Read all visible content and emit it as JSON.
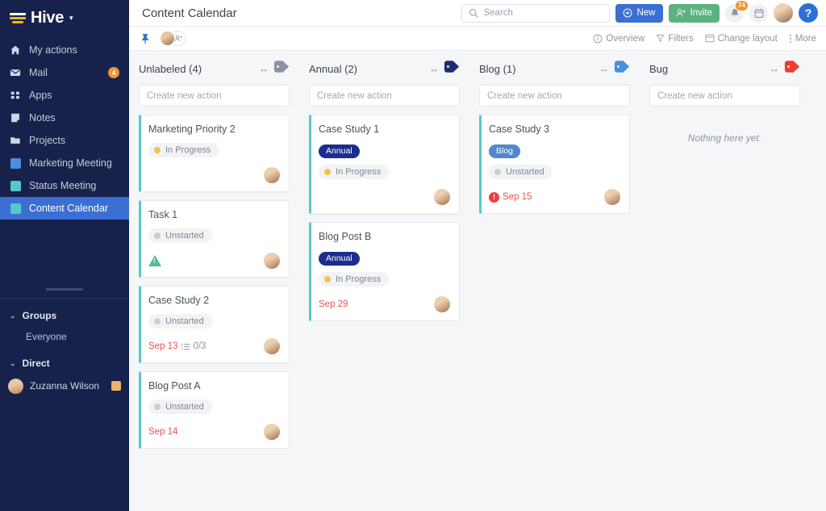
{
  "sidebar": {
    "brand": {
      "name": "Hive",
      "caret": "▾",
      "logo_icon": "hive-logo-icon"
    },
    "nav": [
      {
        "label": "My actions",
        "icon": "home-icon",
        "badge": ""
      },
      {
        "label": "Mail",
        "icon": "mail-icon",
        "badge": "4"
      },
      {
        "label": "Apps",
        "icon": "apps-grid-icon",
        "badge": ""
      },
      {
        "label": "Notes",
        "icon": "notes-icon",
        "badge": ""
      },
      {
        "label": "Projects",
        "icon": "folder-icon",
        "badge": ""
      },
      {
        "label": "Marketing Meeting",
        "icon": "project-square-icon",
        "color": "#4a8fe0",
        "badge": ""
      },
      {
        "label": "Status Meeting",
        "icon": "project-square-icon",
        "color": "#56c8c8",
        "badge": ""
      },
      {
        "label": "Content Calendar",
        "icon": "project-square-icon",
        "color": "#56c8c8",
        "badge": "",
        "active": true
      }
    ],
    "groups": {
      "title": "Groups",
      "chevron": "⌄",
      "items": [
        {
          "label": "Everyone"
        }
      ]
    },
    "direct": {
      "title": "Direct",
      "chevron": "⌄",
      "items": [
        {
          "label": "Zuzanna Wilson",
          "avatar": "user-avatar",
          "note_icon": "note-icon"
        }
      ]
    }
  },
  "topbar": {
    "title": "Content Calendar",
    "search": {
      "placeholder": "Search",
      "icon": "search-icon"
    },
    "new_label": "New",
    "new_icon": "plus-circle-icon",
    "invite_label": "Invite",
    "invite_icon": "add-user-icon",
    "bell_icon": "bell-icon",
    "notification_count": "74",
    "calendar_icon": "calendar-icon",
    "avatar": "user-avatar",
    "help_label": "?",
    "colors": {
      "new": "#3b6fd4",
      "invite": "#5cb27f",
      "badge": "#f0952f",
      "help": "#2d6fdb"
    }
  },
  "subbar": {
    "pin_icon": "pin-icon",
    "member_avatar": "member-avatar",
    "add_member_icon": "add-member-icon",
    "actions": [
      {
        "label": "Overview",
        "icon": "info-circle-icon"
      },
      {
        "label": "Filters",
        "icon": "filter-icon"
      },
      {
        "label": "Change layout",
        "icon": "layout-icon"
      },
      {
        "label": "More",
        "icon": "kebab-menu-icon"
      }
    ]
  },
  "board": {
    "new_action_placeholder": "Create new action",
    "empty_text": "Nothing here yet.",
    "columns": [
      {
        "title": "Unlabeled (4)",
        "tag_color": "#8b93a3",
        "resize_icon": "resize-horizontal-icon",
        "tag_icon": "label-tag-icon",
        "cards": [
          {
            "title": "Marketing Priority 2",
            "label": null,
            "status": "In Progress",
            "status_color": "#f2c14e",
            "due": null,
            "subtasks": null,
            "overdue_alert": false,
            "priority": null,
            "assignee": "user-avatar"
          },
          {
            "title": "Task 1",
            "label": null,
            "status": "Unstarted",
            "status_color": "#c9ced6",
            "due": null,
            "subtasks": null,
            "overdue_alert": false,
            "priority": "low-priority-triangle",
            "assignee": "user-avatar"
          },
          {
            "title": "Case Study 2",
            "label": null,
            "status": "Unstarted",
            "status_color": "#c9ced6",
            "due": "Sep 13",
            "subtasks": "0/3",
            "overdue_alert": false,
            "priority": null,
            "assignee": "user-avatar"
          },
          {
            "title": "Blog Post A",
            "label": null,
            "status": "Unstarted",
            "status_color": "#c9ced6",
            "due": "Sep 14",
            "subtasks": null,
            "overdue_alert": false,
            "priority": null,
            "assignee": "user-avatar"
          }
        ]
      },
      {
        "title": "Annual (2)",
        "tag_color": "#1c2e73",
        "resize_icon": "resize-horizontal-icon",
        "tag_icon": "label-tag-icon",
        "cards": [
          {
            "title": "Case Study 1",
            "label": "Annual",
            "label_color": "#1c2e8c",
            "status": "In Progress",
            "status_color": "#f2c14e",
            "due": null,
            "subtasks": null,
            "overdue_alert": false,
            "priority": null,
            "assignee": "user-avatar"
          },
          {
            "title": "Blog Post B",
            "label": "Annual",
            "label_color": "#1c2e8c",
            "status": "In Progress",
            "status_color": "#f2c14e",
            "due": "Sep 29",
            "subtasks": null,
            "overdue_alert": false,
            "priority": null,
            "assignee": "user-avatar"
          }
        ]
      },
      {
        "title": "Blog (1)",
        "tag_color": "#4a8fe0",
        "resize_icon": "resize-horizontal-icon",
        "tag_icon": "label-tag-icon",
        "cards": [
          {
            "title": "Case Study 3",
            "label": "Blog",
            "label_color": "#5287cc",
            "status": "Unstarted",
            "status_color": "#c9ced6",
            "due": "Sep 15",
            "subtasks": null,
            "overdue_alert": true,
            "priority": null,
            "assignee": "user-avatar"
          }
        ]
      },
      {
        "title": "Bug",
        "tag_color": "#ee3b33",
        "resize_icon": "resize-horizontal-icon",
        "tag_icon": "label-tag-icon",
        "cards": []
      }
    ]
  }
}
